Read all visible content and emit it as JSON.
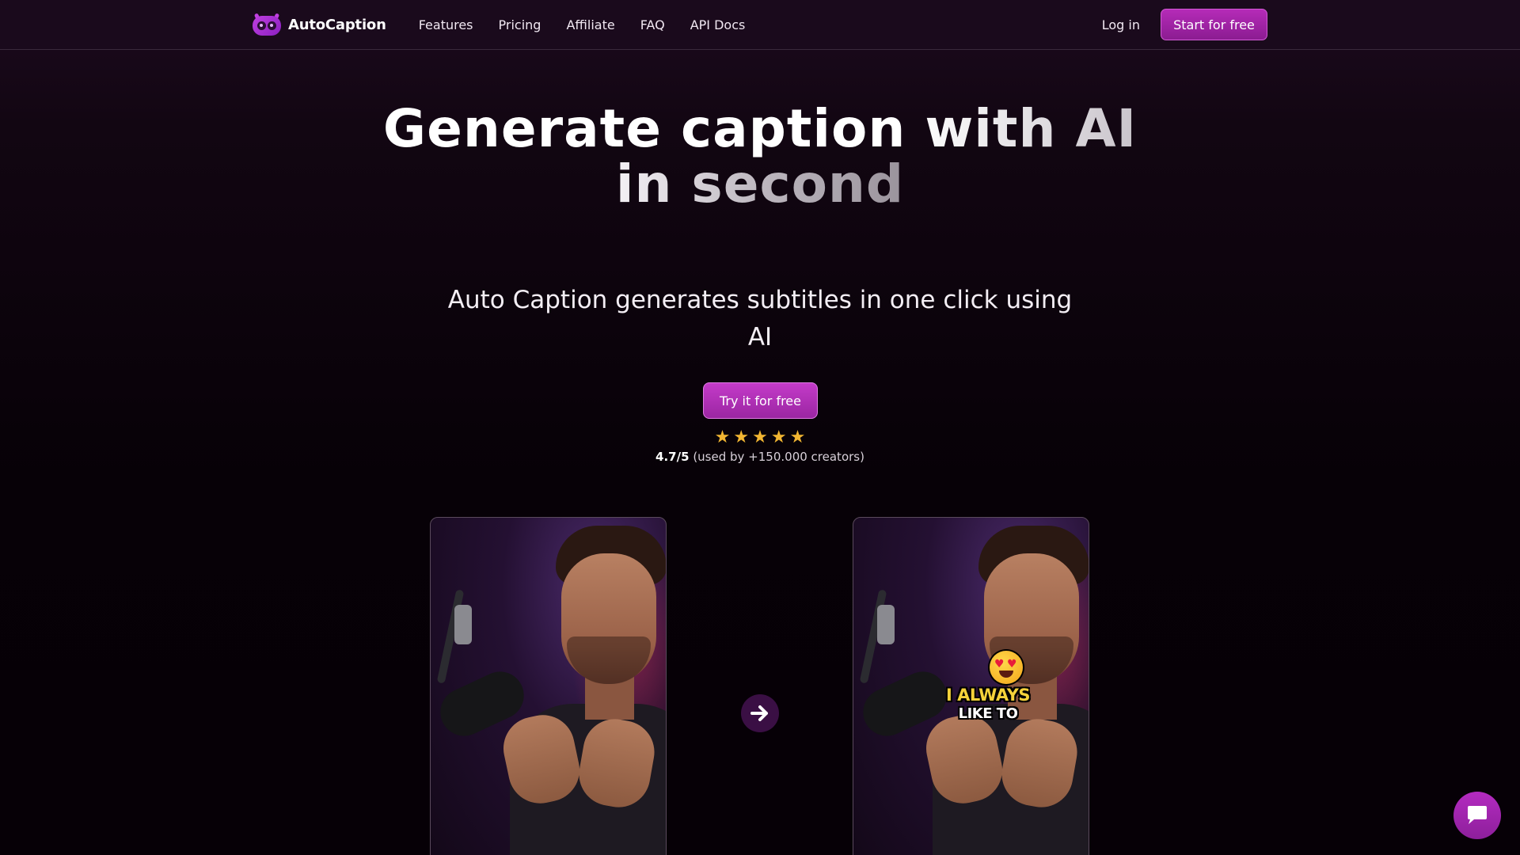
{
  "nav": {
    "brand": "AutoCaption",
    "links": [
      "Features",
      "Pricing",
      "Affiliate",
      "FAQ",
      "API Docs"
    ],
    "login": "Log in",
    "cta": "Start for free"
  },
  "hero": {
    "title_line1": "Generate caption with AI",
    "title_line2": "in second",
    "subtitle": "Auto Caption generates subtitles in one click using AI",
    "cta": "Try it for free",
    "stars": 5,
    "rating_score": "4.7/5",
    "rating_text": "(used by +150.000 creators)"
  },
  "demo": {
    "caption_line1": "I ALWAYS",
    "caption_line2": "LIKE TO"
  },
  "icons": {
    "brand_logo": "robot-face-icon",
    "arrow": "arrow-right-icon",
    "chat": "chat-bubble-icon",
    "star": "star-icon"
  },
  "colors": {
    "accent": "#b52bb8",
    "star": "#f2b632",
    "caption_yellow": "#f5d23a"
  }
}
